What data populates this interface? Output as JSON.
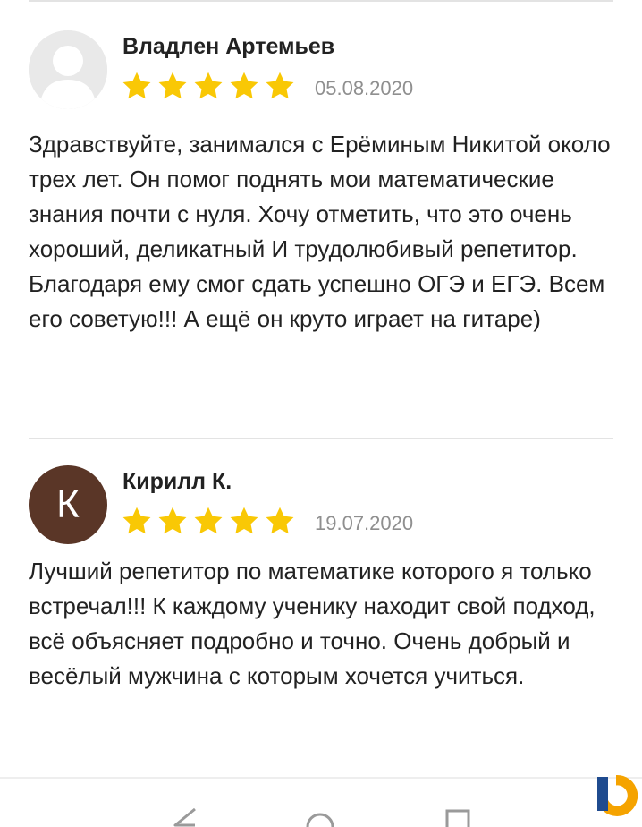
{
  "reviews": [
    {
      "author": "Владлен Артемьев",
      "avatar": {
        "type": "photo-placeholder",
        "icon": "user-silhouette-icon"
      },
      "rating": 5,
      "date": "05.08.2020",
      "text": "Здравствуйте, занимался с Ерёминым Никитой около трех лет. Он помог поднять мои математические знания почти с нуля. Хочу отметить, что это очень хороший, деликатный И трудолюбивый репетитор. Благодаря ему смог сдать успешно ОГЭ и ЕГЭ. Всем его советую!!! А ещё он круто играет на гитаре)"
    },
    {
      "author": "Кирилл К.",
      "avatar": {
        "type": "letter",
        "letter": "К",
        "color": "#5a3627"
      },
      "rating": 5,
      "date": "19.07.2020",
      "text": "Лучший репетитор по математике которого я только встречал!!! К каждому ученику находит свой подход, всё объясняет подробно и точно. Очень добрый и весёлый мужчина с которым хочется учиться."
    }
  ],
  "colors": {
    "star": "#f9c805",
    "date": "#8f8f8f",
    "divider": "#e3e3e3",
    "brand_orange": "#f5a300",
    "brand_blue": "#1f4b8f"
  },
  "navbar": {
    "icons": [
      "back-icon",
      "home-icon",
      "recent-apps-icon"
    ]
  },
  "brand": {
    "icon": "brand-logo-icon"
  }
}
